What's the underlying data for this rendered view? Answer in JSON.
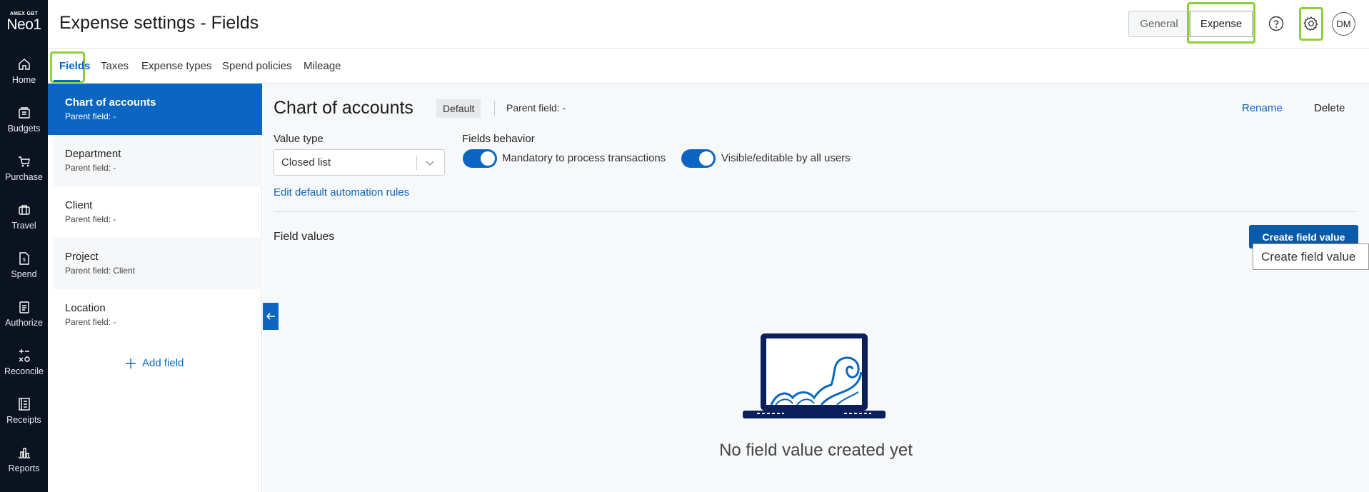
{
  "brand": {
    "small": "AMEX GBT",
    "big": "Neo1"
  },
  "nav": [
    {
      "label": "Home",
      "icon": "home-icon"
    },
    {
      "label": "Budgets",
      "icon": "budgets-icon"
    },
    {
      "label": "Purchase",
      "icon": "cart-icon"
    },
    {
      "label": "Travel",
      "icon": "luggage-icon"
    },
    {
      "label": "Spend",
      "icon": "spend-icon"
    },
    {
      "label": "Authorize",
      "icon": "clipboard-icon"
    },
    {
      "label": "Reconcile",
      "icon": "reconcile-icon"
    },
    {
      "label": "Receipts",
      "icon": "receipts-icon"
    },
    {
      "label": "Reports",
      "icon": "bar-chart-icon"
    }
  ],
  "header": {
    "title": "Expense settings - Fields",
    "segment_general": "General",
    "segment_expense": "Expense",
    "avatar_initials": "DM"
  },
  "tabs": [
    "Fields",
    "Taxes",
    "Expense types",
    "Spend policies",
    "Mileage"
  ],
  "fields": [
    {
      "name": "Chart of accounts",
      "parent": "Parent field:  -"
    },
    {
      "name": "Department",
      "parent": "Parent field:  -"
    },
    {
      "name": "Client",
      "parent": "Parent field:  -"
    },
    {
      "name": "Project",
      "parent": "Parent field:  Client"
    },
    {
      "name": "Location",
      "parent": "Parent field:  -"
    }
  ],
  "add_field_label": "Add field",
  "detail": {
    "title": "Chart of accounts",
    "badge": "Default",
    "parent_field": "Parent field:  -",
    "rename": "Rename",
    "delete": "Delete",
    "value_type_label": "Value type",
    "value_type_value": "Closed list",
    "fields_behavior_label": "Fields behavior",
    "toggle1_label": "Mandatory to process transactions",
    "toggle2_label": "Visible/editable by all users",
    "edit_rules": "Edit default automation rules",
    "field_values_title": "Field values",
    "create_button": "Create field value",
    "tooltip": "Create field value",
    "empty_message": "No field value created yet"
  },
  "colors": {
    "accent": "#0a66c2",
    "highlight": "#8bd03b",
    "nav_bg": "#0b1220"
  }
}
